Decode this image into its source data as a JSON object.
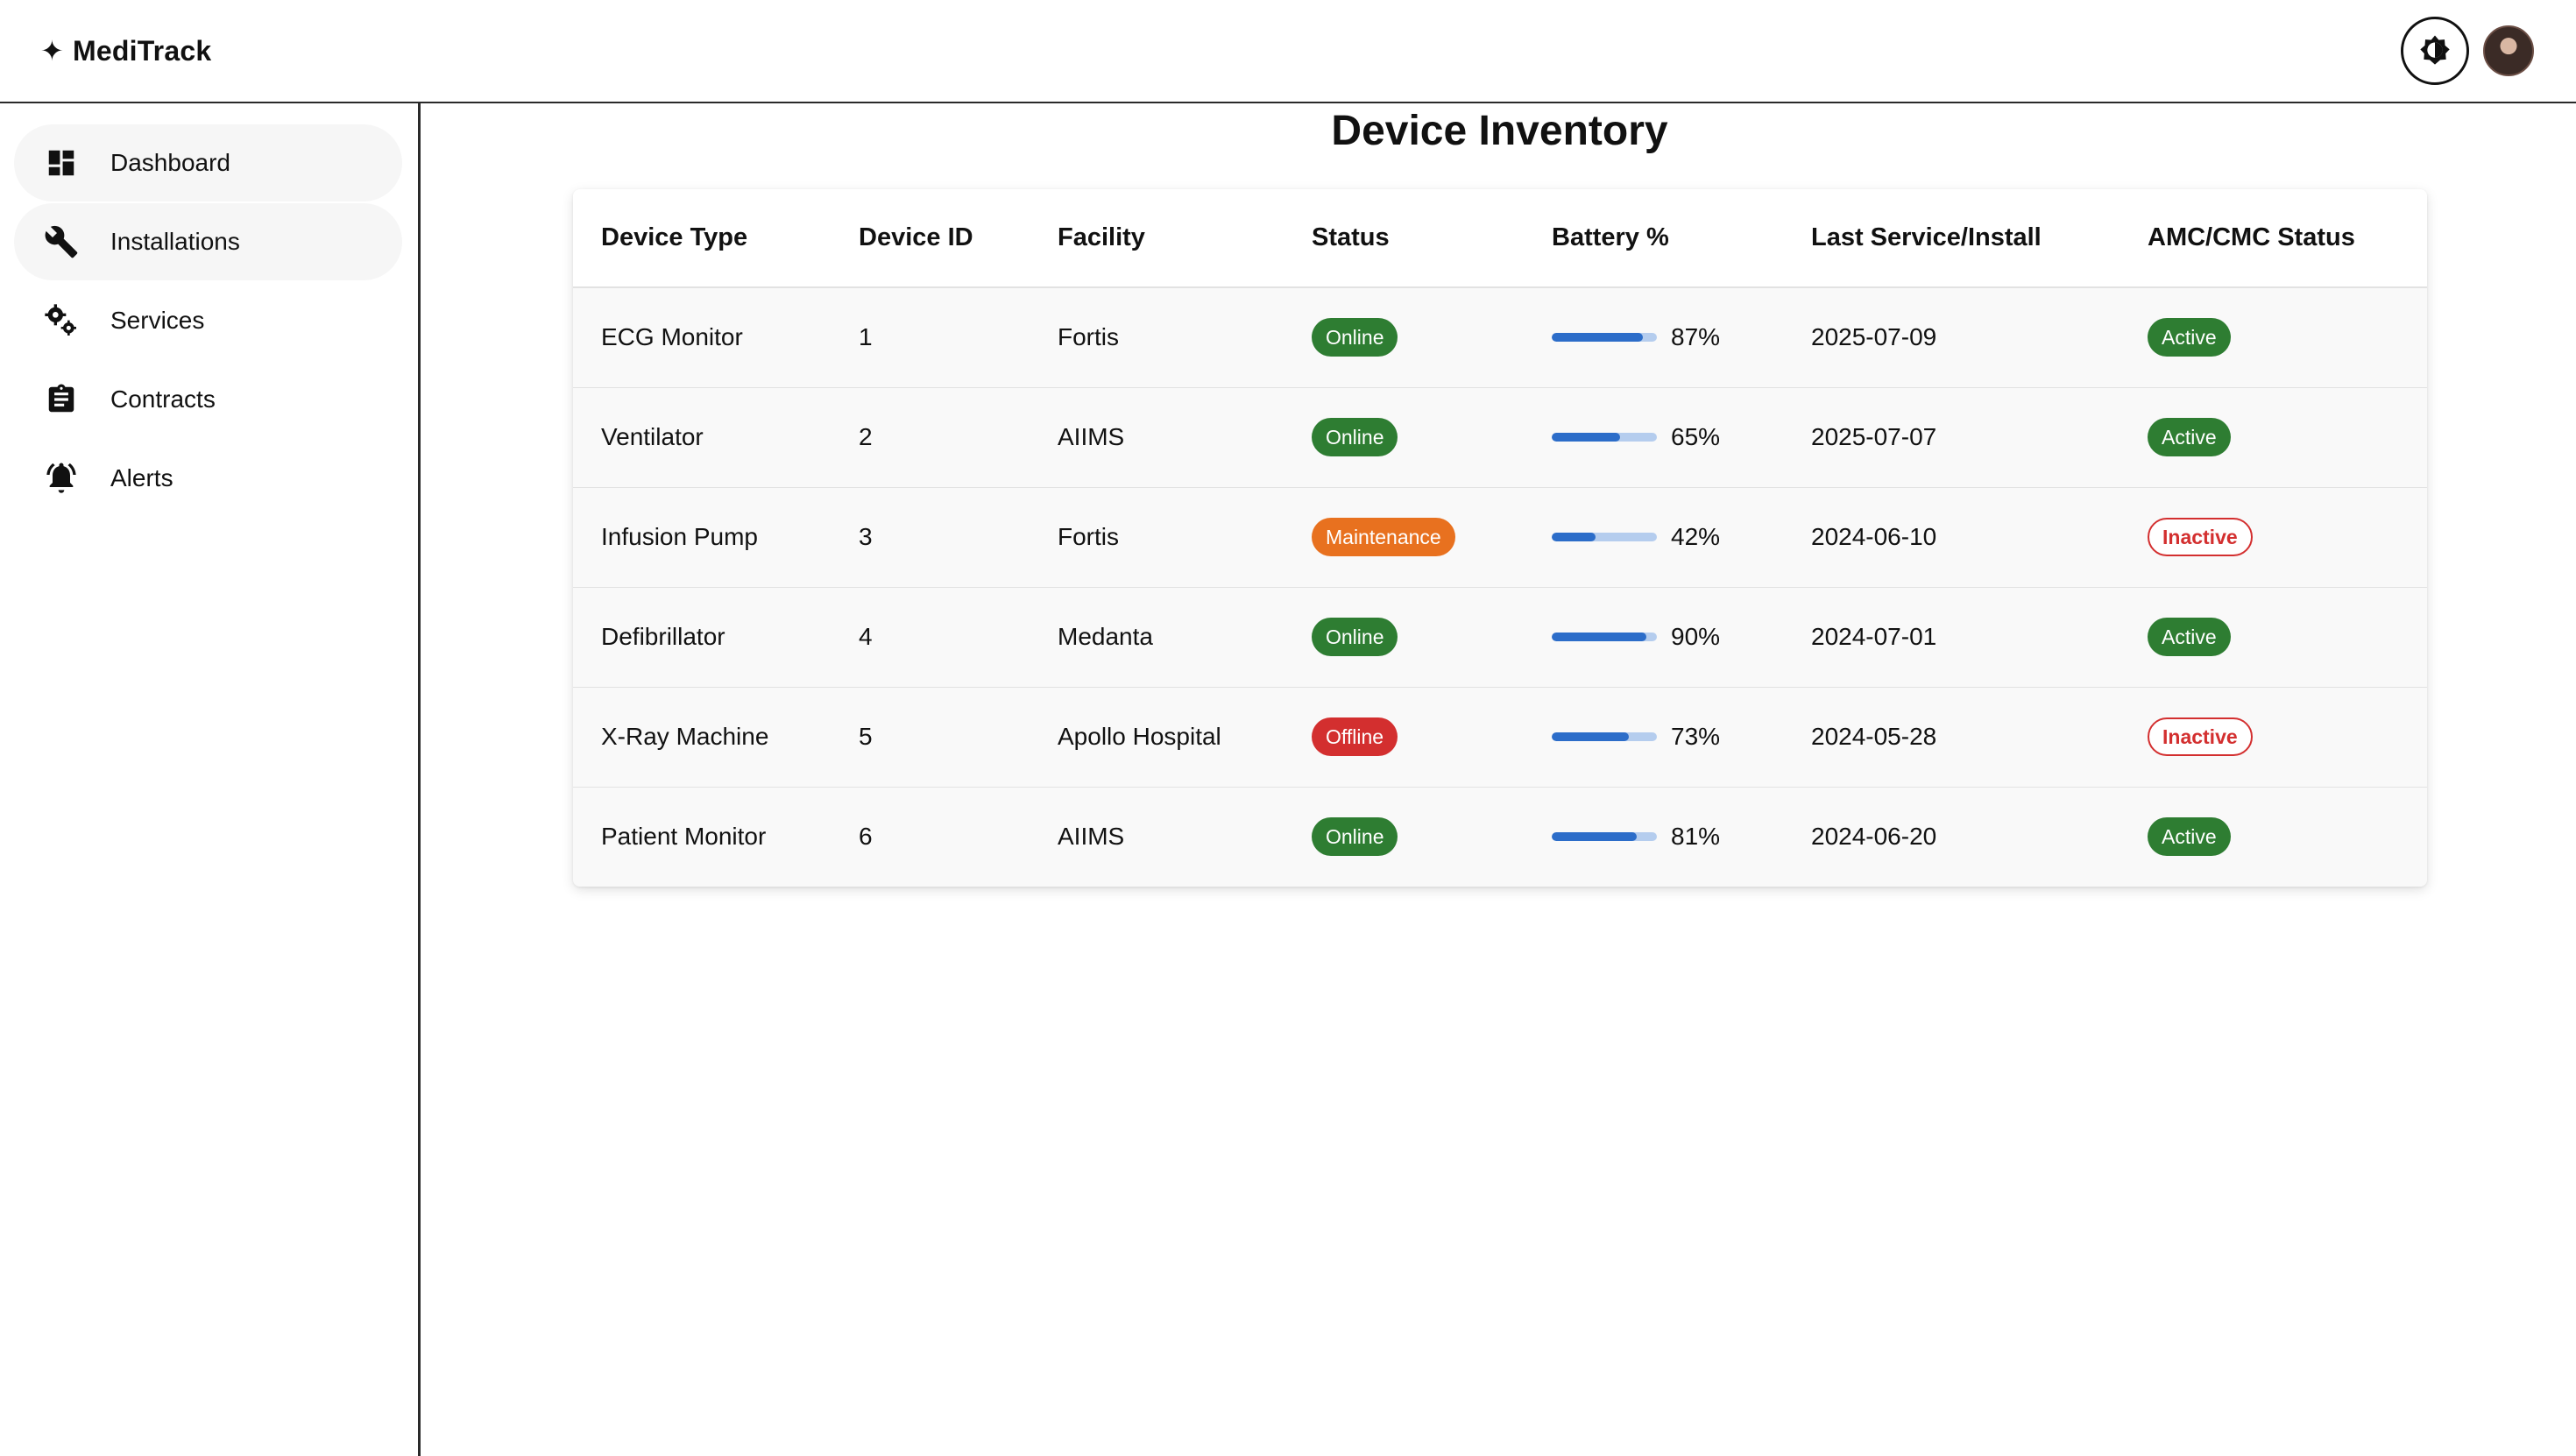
{
  "app": {
    "brand_star": "✦",
    "brand": "MediTrack"
  },
  "icons": {
    "theme_toggle": "brightness-icon",
    "avatar": "user-avatar"
  },
  "sidebar": {
    "items": [
      {
        "label": "Dashboard",
        "icon": "dashboard-icon"
      },
      {
        "label": "Installations",
        "icon": "wrench-icon"
      },
      {
        "label": "Services",
        "icon": "gears-icon"
      },
      {
        "label": "Contracts",
        "icon": "clipboard-icon"
      },
      {
        "label": "Alerts",
        "icon": "bell-icon"
      }
    ]
  },
  "page": {
    "title": "Device Inventory"
  },
  "table": {
    "headers": [
      "Device Type",
      "Device ID",
      "Facility",
      "Status",
      "Battery %",
      "Last Service/Install",
      "AMC/CMC Status"
    ],
    "rows": [
      {
        "type": "ECG Monitor",
        "id": "1",
        "facility": "Fortis",
        "status": "Online",
        "battery_text": "87%",
        "battery": 87,
        "last": "2025-07-09",
        "amc": "Active"
      },
      {
        "type": "Ventilator",
        "id": "2",
        "facility": "AIIMS",
        "status": "Online",
        "battery_text": "65%",
        "battery": 65,
        "last": "2025-07-07",
        "amc": "Active"
      },
      {
        "type": "Infusion Pump",
        "id": "3",
        "facility": "Fortis",
        "status": "Maintenance",
        "battery_text": "42%",
        "battery": 42,
        "last": "2024-06-10",
        "amc": "Inactive"
      },
      {
        "type": "Defibrillator",
        "id": "4",
        "facility": "Medanta",
        "status": "Online",
        "battery_text": "90%",
        "battery": 90,
        "last": "2024-07-01",
        "amc": "Active"
      },
      {
        "type": "X-Ray Machine",
        "id": "5",
        "facility": "Apollo Hospital",
        "status": "Offline",
        "battery_text": "73%",
        "battery": 73,
        "last": "2024-05-28",
        "amc": "Inactive"
      },
      {
        "type": "Patient Monitor",
        "id": "6",
        "facility": "AIIMS",
        "status": "Online",
        "battery_text": "81%",
        "battery": 81,
        "last": "2024-06-20",
        "amc": "Active"
      }
    ]
  },
  "colors": {
    "online": "#2e7d32",
    "maintenance": "#e8711f",
    "offline": "#d32f2f",
    "battery_fill": "#2c6dc9",
    "battery_track": "#b5cdee"
  }
}
